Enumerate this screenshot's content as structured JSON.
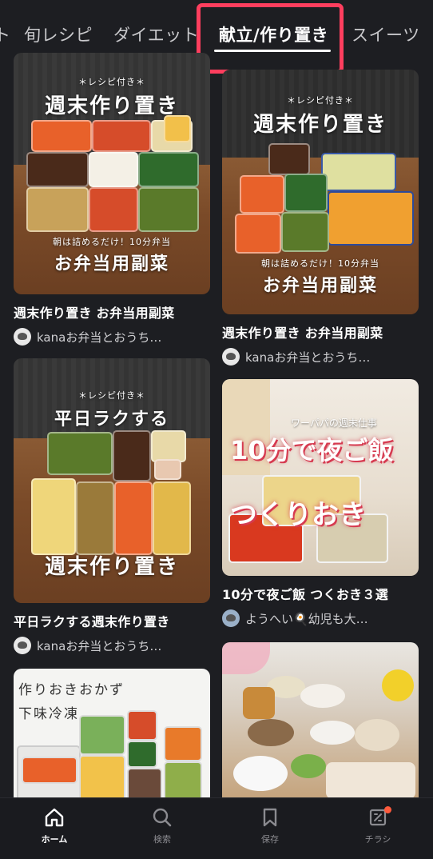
{
  "tabs": [
    {
      "label": "ト"
    },
    {
      "label": "旬レシピ"
    },
    {
      "label": "ダイエット"
    },
    {
      "label": "献立/作り置き",
      "active": true
    },
    {
      "label": "スイーツ"
    }
  ],
  "cards": [
    {
      "title": "週末作り置き お弁当用副菜",
      "author": "kanaお弁当とおうち…",
      "image_text": {
        "small": "＊レシピ付き＊",
        "headline": "週末作り置き",
        "note": "朝は詰めるだけ！10分弁当",
        "footer": "お弁当用副菜"
      }
    },
    {
      "title": "週末作り置き お弁当用副菜",
      "author": "kanaお弁当とおうち…",
      "image_text": {
        "small": "＊レシピ付き＊",
        "headline": "週末作り置き",
        "note": "朝は詰めるだけ！10分弁当",
        "footer": "お弁当用副菜"
      }
    },
    {
      "title": "平日ラクする週末作り置き",
      "author": "kanaお弁当とおうち…",
      "image_text": {
        "small": "＊レシピ付き＊",
        "headline": "平日ラクする",
        "footer": "週末作り置き"
      }
    },
    {
      "title": "10分で夜ご飯 つくおき３選",
      "author": "ようへい🍳幼児も大…",
      "image_text": {
        "small": "ワーパパの週末仕事",
        "headline": "10分で夜ご飯",
        "footer": "つくりおき"
      }
    },
    {
      "image_text": {
        "line1": "作りおきおかず",
        "line2": "下味冷凍"
      }
    },
    {
      "image_text": {}
    }
  ],
  "bottom_nav": [
    {
      "label": "ホーム",
      "icon": "home-icon",
      "active": true
    },
    {
      "label": "検索",
      "icon": "search-icon"
    },
    {
      "label": "保存",
      "icon": "bookmark-icon"
    },
    {
      "label": "チラシ",
      "icon": "flyer-icon",
      "badge": true
    }
  ],
  "colors": {
    "background": "#1d1e22",
    "highlight": "#ff3e5e",
    "badge": "#ff5a3c"
  }
}
